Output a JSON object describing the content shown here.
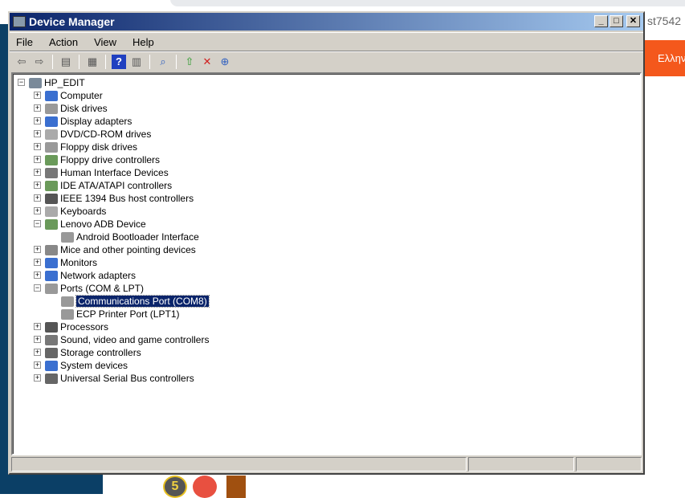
{
  "background": {
    "url_fragment": "st7542",
    "orange_label": "Ελλην",
    "badge_number": "5"
  },
  "window": {
    "title": "Device Manager",
    "minimize": "_",
    "maximize": "□",
    "close": "✕"
  },
  "menu": [
    "File",
    "Action",
    "View",
    "Help"
  ],
  "toolbar": [
    "back-icon",
    "forward-icon",
    "show-hide-console-tree-icon",
    "properties-icon",
    "help-icon",
    "show-action-pane-icon",
    "scan-hardware-icon",
    "update-driver-icon",
    "uninstall-icon",
    "disable-icon"
  ],
  "tree": {
    "root": "HP_EDIT",
    "items": [
      {
        "label": "Computer",
        "expanded": false,
        "color": "#3a6fd0"
      },
      {
        "label": "Disk drives",
        "expanded": false,
        "color": "#999999"
      },
      {
        "label": "Display adapters",
        "expanded": false,
        "color": "#3a6fd0"
      },
      {
        "label": "DVD/CD-ROM drives",
        "expanded": false,
        "color": "#aaaaaa"
      },
      {
        "label": "Floppy disk drives",
        "expanded": false,
        "color": "#999999"
      },
      {
        "label": "Floppy drive controllers",
        "expanded": false,
        "color": "#6a9a5a"
      },
      {
        "label": "Human Interface Devices",
        "expanded": false,
        "color": "#777777"
      },
      {
        "label": "IDE ATA/ATAPI controllers",
        "expanded": false,
        "color": "#6a9a5a"
      },
      {
        "label": "IEEE 1394 Bus host controllers",
        "expanded": false,
        "color": "#555555"
      },
      {
        "label": "Keyboards",
        "expanded": false,
        "color": "#aaaaaa"
      },
      {
        "label": "Lenovo ADB Device",
        "expanded": true,
        "color": "#6a9a5a",
        "children": [
          {
            "label": "Android Bootloader Interface",
            "selected": false
          }
        ]
      },
      {
        "label": "Mice and other pointing devices",
        "expanded": false,
        "color": "#888888"
      },
      {
        "label": "Monitors",
        "expanded": false,
        "color": "#3a6fd0"
      },
      {
        "label": "Network adapters",
        "expanded": false,
        "color": "#3a6fd0"
      },
      {
        "label": "Ports (COM & LPT)",
        "expanded": true,
        "color": "#999999",
        "children": [
          {
            "label": "Communications Port (COM8)",
            "selected": true
          },
          {
            "label": "ECP Printer Port (LPT1)",
            "selected": false
          }
        ]
      },
      {
        "label": "Processors",
        "expanded": false,
        "color": "#555555"
      },
      {
        "label": "Sound, video and game controllers",
        "expanded": false,
        "color": "#777777"
      },
      {
        "label": "Storage controllers",
        "expanded": false,
        "color": "#666666"
      },
      {
        "label": "System devices",
        "expanded": false,
        "color": "#3a6fd0"
      },
      {
        "label": "Universal Serial Bus controllers",
        "expanded": false,
        "color": "#666666"
      }
    ]
  }
}
